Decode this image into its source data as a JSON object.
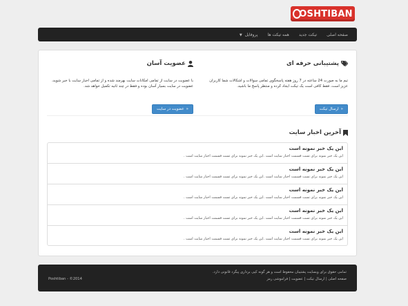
{
  "logo": {
    "text": "OSHTIBAN"
  },
  "nav": {
    "items": [
      "صفحه اصلی",
      "تیکت جدید",
      "همه تیکت ها",
      "پروفایل"
    ]
  },
  "support": {
    "title": "پشتیبانی حرفه ای",
    "text": "تیم ما به صورت 24 ساعته در 7 روز هفته پاسخگوی تمامی سوالات و اشکالات شما کاربران عزیز است، فقط کافی است یک تیکت ایجاد کرده و منتظر پاسخ ما باشید.",
    "button": "ارسال تیکت"
  },
  "membership": {
    "title": "عضویت آسان",
    "text": "با عضویت در سایت از تمامی امکانات سایت بهرمند شده و از تمامی اخبار سایت با خبر شوید، عضویت در سایت بسیار آسان بوده و فقط در چند ثانیه تکمیل خواهد شد.",
    "button": "عضویت در سایت"
  },
  "news": {
    "title": "آخرین اخبار سایت",
    "items": [
      {
        "title": "این یک خبر نمونه است",
        "text": "این یک خبر نمونه برای تست قسمت اخبار سایت است .این یک خبر نمونه برای تست قسمت اخبار سایت است ."
      },
      {
        "title": "این یک خبر نمونه است",
        "text": "این یک خبر نمونه برای تست قسمت اخبار سایت است .این یک خبر نمونه برای تست قسمت اخبار سایت است ."
      },
      {
        "title": "این یک خبر نمونه است",
        "text": "این یک خبر نمونه برای تست قسمت اخبار سایت است .این یک خبر نمونه برای تست قسمت اخبار سایت است ."
      },
      {
        "title": "این یک خبر نمونه است",
        "text": "این یک خبر نمونه برای تست قسمت اخبار سایت است .این یک خبر نمونه برای تست قسمت اخبار سایت است ."
      },
      {
        "title": "این یک خبر نمونه است",
        "text": "این یک خبر نمونه برای تست قسمت اخبار سایت است .این یک خبر نمونه برای تست قسمت اخبار سایت است ."
      }
    ]
  },
  "footer": {
    "notice": "تمامی حقوق برای وبسایت پشتیبان محفوظ است و هر گونه کپی برداری پیگرد قانونی دارد.",
    "links": [
      "صفحه اصلی",
      "ارسال تیکت",
      "عضویت",
      "فراموشی رمز"
    ],
    "separator": " | ",
    "copyright": "Poshtiban - ©2014"
  },
  "colors": {
    "logo": "#d9322b",
    "navbar": "#222222",
    "primary_button": "#428bca"
  },
  "icons": {
    "support": "tags-icon",
    "membership": "user-icon",
    "news": "bookmark-icon",
    "button": "arrow-icon"
  }
}
